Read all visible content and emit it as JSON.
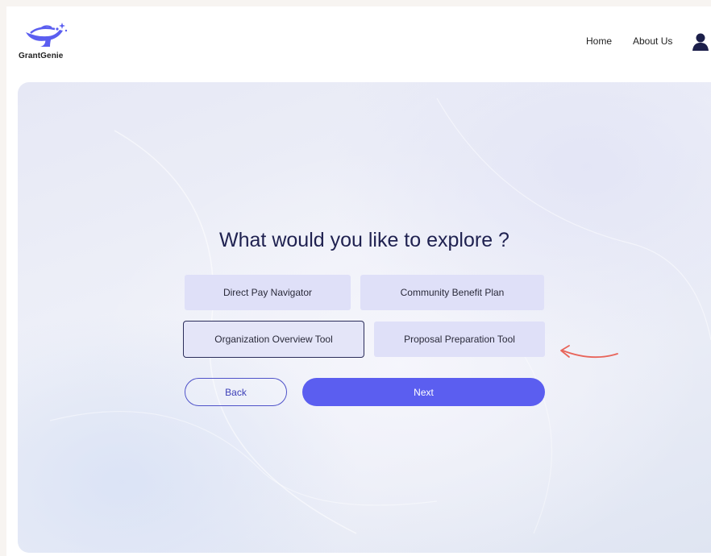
{
  "brand": {
    "name": "GrantGenie"
  },
  "nav": {
    "home": "Home",
    "about": "About Us"
  },
  "main": {
    "question": "What would you like to explore ?",
    "options": [
      {
        "label": "Direct Pay Navigator",
        "selected": false
      },
      {
        "label": "Community Benefit Plan",
        "selected": false
      },
      {
        "label": "Organization Overview Tool",
        "selected": true
      },
      {
        "label": "Proposal Preparation Tool",
        "selected": false
      }
    ],
    "back_label": "Back",
    "next_label": "Next"
  },
  "icons": {
    "logo": "genie-lamp-logo",
    "profile": "user-icon",
    "pointer": "arrow-icon"
  },
  "colors": {
    "accent": "#5b5ef0",
    "title": "#1f2150",
    "option_bg": "#dfe0f8",
    "selected_border": "#2b2d5a",
    "annotation": "#e8645a"
  }
}
